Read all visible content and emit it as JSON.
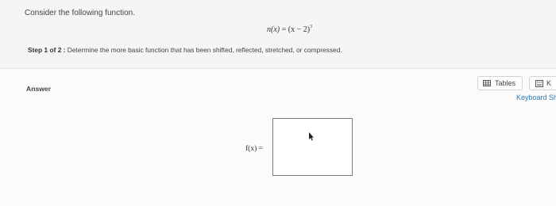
{
  "question": {
    "prompt": "Consider the following function.",
    "function_lhs": "n(x)",
    "function_eq": "=",
    "function_base": "(x − 2)",
    "function_exponent": "3",
    "step_label": "Step 1 of 2 :",
    "step_text": "Determine the more basic function that has been shifted, reflected, stretched, or compressed."
  },
  "answer": {
    "label": "Answer",
    "fx_label": "f(x) =",
    "input_value": ""
  },
  "toolbar": {
    "tables_label": "Tables",
    "tables_icon": "table-icon",
    "keyboard_btn_label": "K",
    "keyboard_icon": "keyboard-icon",
    "keyboard_link": "Keyboard Sh"
  },
  "colors": {
    "link": "#2a7ab8",
    "box_border": "#7a7a7a"
  }
}
